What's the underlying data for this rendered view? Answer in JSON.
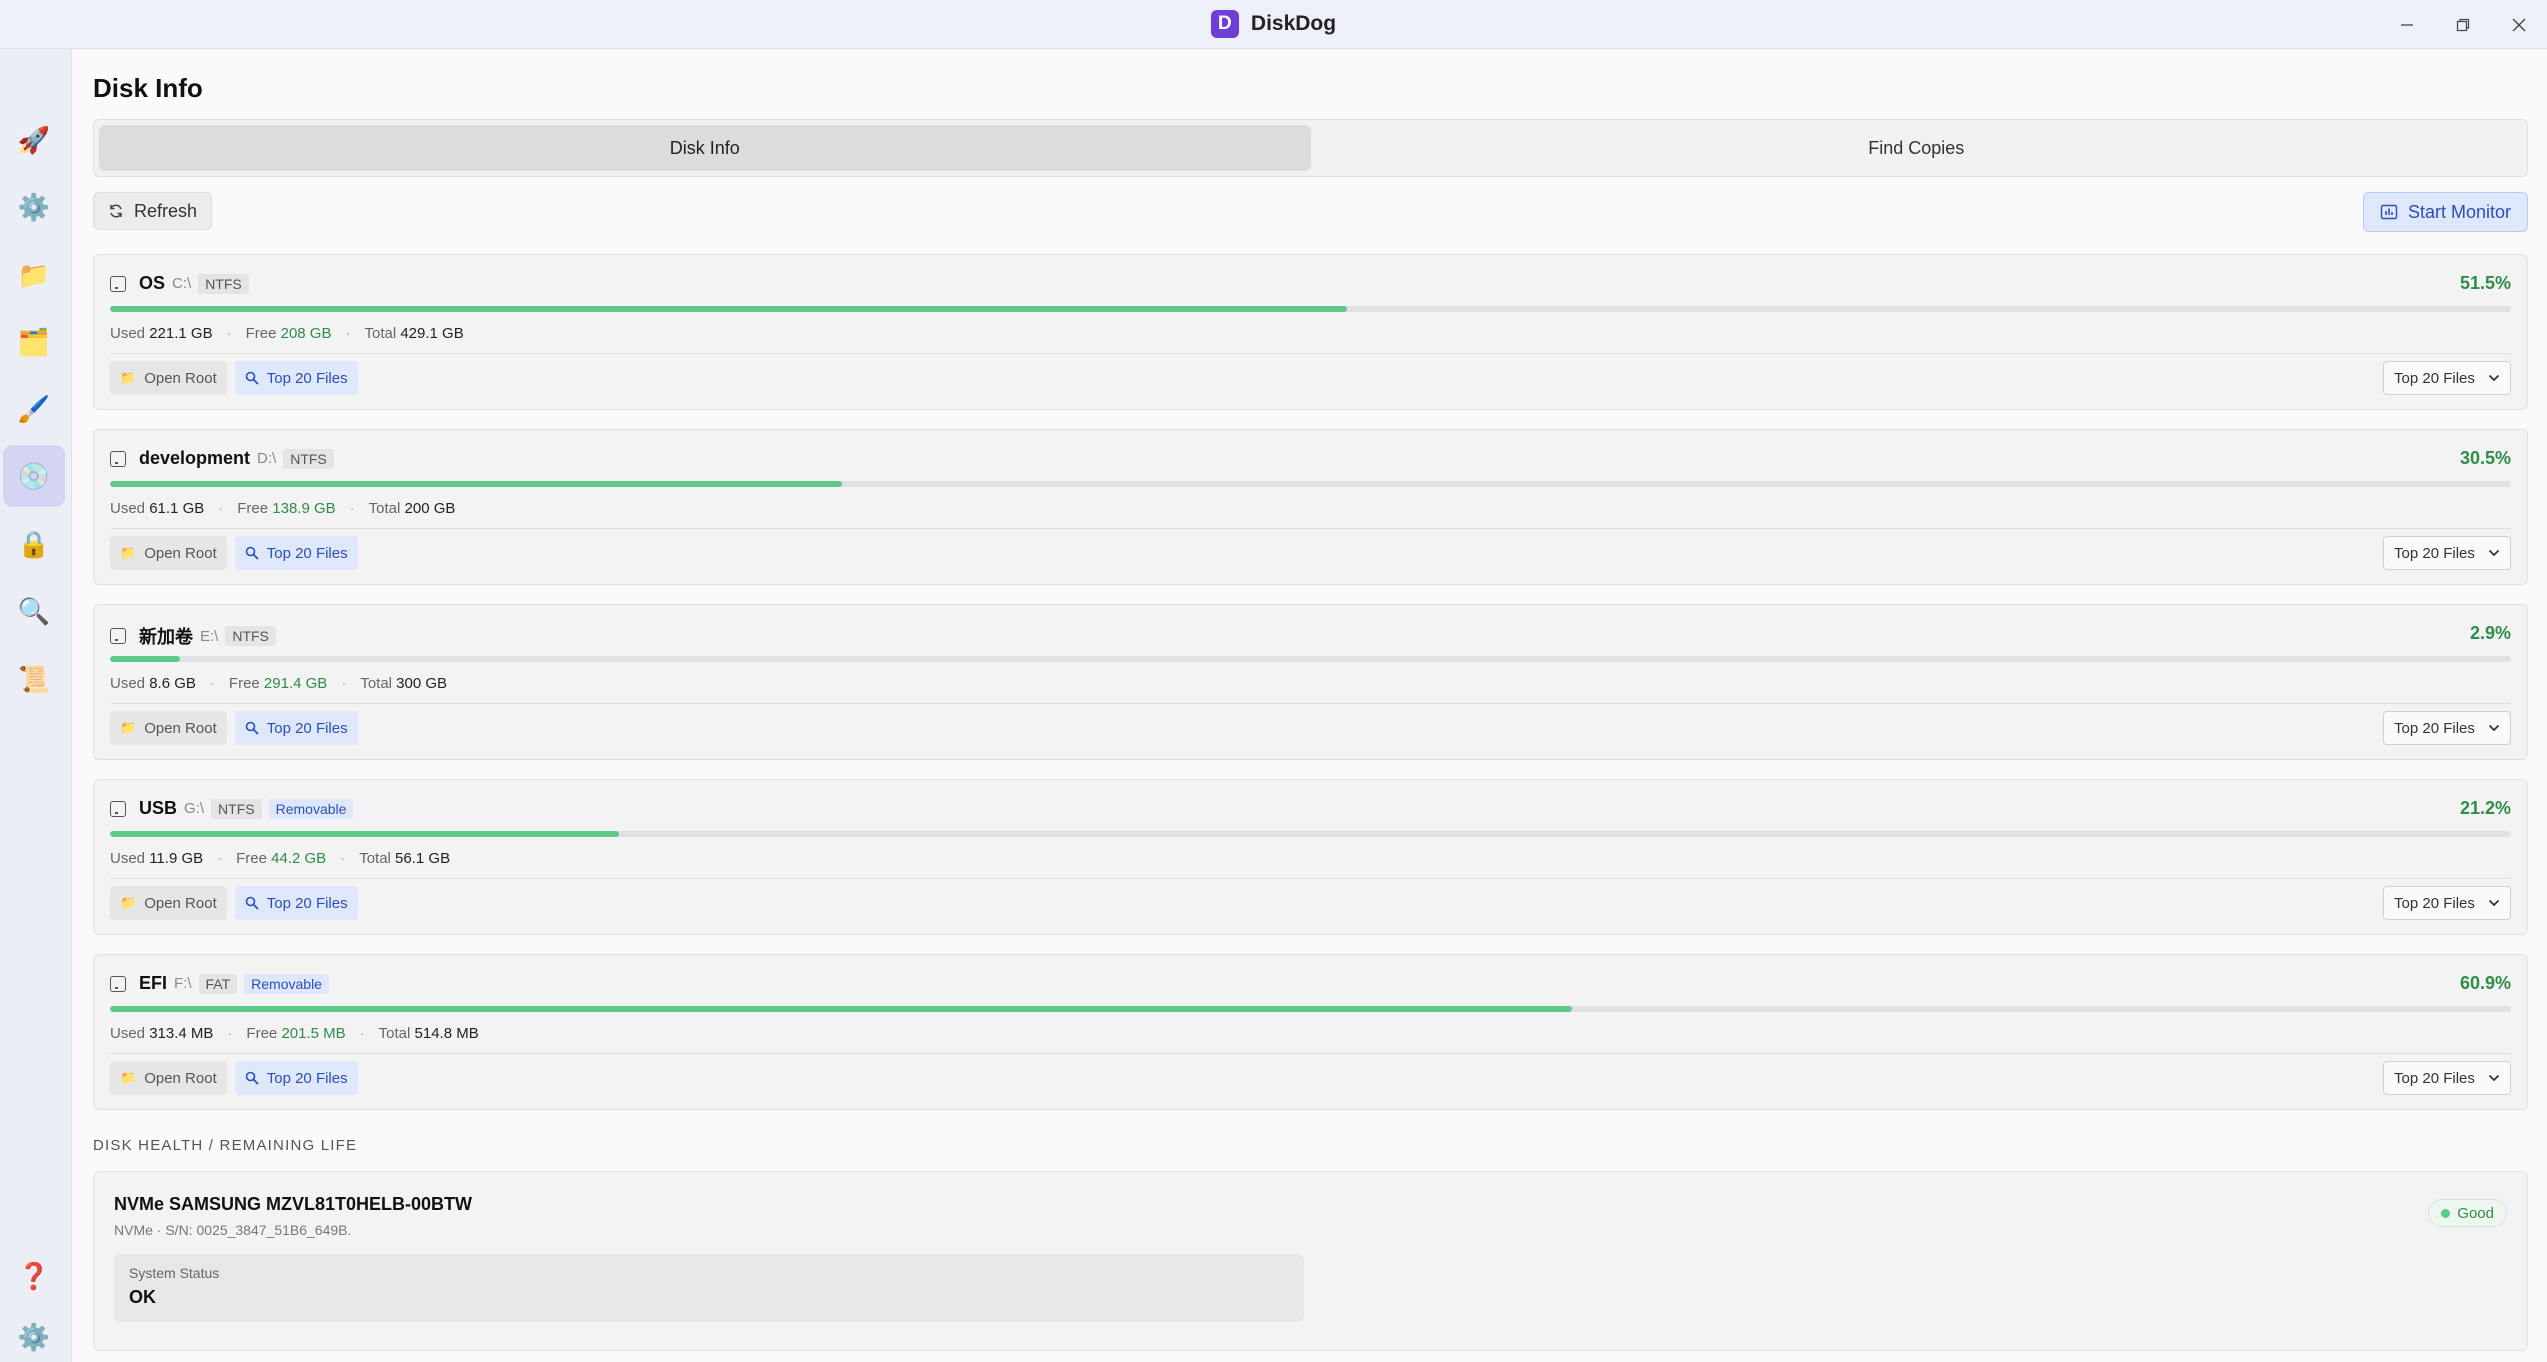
{
  "window": {
    "title": "DiskDog",
    "logo_letter": "D"
  },
  "sidebar": {
    "items": [
      {
        "icon": "rocket-icon",
        "glyph": "🚀"
      },
      {
        "icon": "gear-icon",
        "glyph": "⚙️"
      },
      {
        "icon": "folder-icon",
        "glyph": "📁"
      },
      {
        "icon": "folders-icon",
        "glyph": "🗂️"
      },
      {
        "icon": "broom-icon",
        "glyph": "🖌️"
      },
      {
        "icon": "disk-icon",
        "glyph": "💿"
      },
      {
        "icon": "lock-icon",
        "glyph": "🔒"
      },
      {
        "icon": "search-icon",
        "glyph": "🔍"
      },
      {
        "icon": "scroll-icon",
        "glyph": "📜"
      }
    ],
    "bottom": [
      {
        "icon": "help-icon",
        "glyph": "❓"
      },
      {
        "icon": "settings-icon",
        "glyph": "⚙️"
      }
    ]
  },
  "page": {
    "title": "Disk Info"
  },
  "tabs": [
    {
      "label": "Disk Info"
    },
    {
      "label": "Find Copies"
    }
  ],
  "toolbar": {
    "refresh_label": "Refresh",
    "monitor_label": "Start Monitor"
  },
  "disks": [
    {
      "name": "OS",
      "letter": "C:\\",
      "fs": "NTFS",
      "removable": "",
      "percent": "51.5%",
      "fill": 0.515,
      "used_label": "Used",
      "used": "221.1 GB",
      "free_label": "Free",
      "free": "208 GB",
      "total_label": "Total",
      "total": "429.1 GB",
      "open_label": "Open Root",
      "top_label": "Top 20 Files",
      "select_value": "Top 20 Files"
    },
    {
      "name": "development",
      "letter": "D:\\",
      "fs": "NTFS",
      "removable": "",
      "percent": "30.5%",
      "fill": 0.305,
      "used_label": "Used",
      "used": "61.1 GB",
      "free_label": "Free",
      "free": "138.9 GB",
      "total_label": "Total",
      "total": "200 GB",
      "open_label": "Open Root",
      "top_label": "Top 20 Files",
      "select_value": "Top 20 Files"
    },
    {
      "name": "新加卷",
      "letter": "E:\\",
      "fs": "NTFS",
      "removable": "",
      "percent": "2.9%",
      "fill": 0.029,
      "used_label": "Used",
      "used": "8.6 GB",
      "free_label": "Free",
      "free": "291.4 GB",
      "total_label": "Total",
      "total": "300 GB",
      "open_label": "Open Root",
      "top_label": "Top 20 Files",
      "select_value": "Top 20 Files"
    },
    {
      "name": "USB",
      "letter": "G:\\",
      "fs": "NTFS",
      "removable": "Removable",
      "percent": "21.2%",
      "fill": 0.212,
      "used_label": "Used",
      "used": "11.9 GB",
      "free_label": "Free",
      "free": "44.2 GB",
      "total_label": "Total",
      "total": "56.1 GB",
      "open_label": "Open Root",
      "top_label": "Top 20 Files",
      "select_value": "Top 20 Files"
    },
    {
      "name": "EFI",
      "letter": "F:\\",
      "fs": "FAT",
      "removable": "Removable",
      "percent": "60.9%",
      "fill": 0.609,
      "used_label": "Used",
      "used": "313.4 MB",
      "free_label": "Free",
      "free": "201.5 MB",
      "total_label": "Total",
      "total": "514.8 MB",
      "open_label": "Open Root",
      "top_label": "Top 20 Files",
      "select_value": "Top 20 Files"
    }
  ],
  "health": {
    "section_label": "DISK HEALTH / REMAINING LIFE",
    "device_name": "NVMe SAMSUNG MZVL81T0HELB-00BTW",
    "device_sub": "NVMe · S/N: 0025_3847_51B6_649B.",
    "status_badge": "Good",
    "status_label": "System Status",
    "status_value": "OK"
  },
  "colors": {
    "accent": "#6d3fd6",
    "good": "#2f8c4a",
    "bar": "#5fc98a",
    "link": "#2b4fb8"
  }
}
